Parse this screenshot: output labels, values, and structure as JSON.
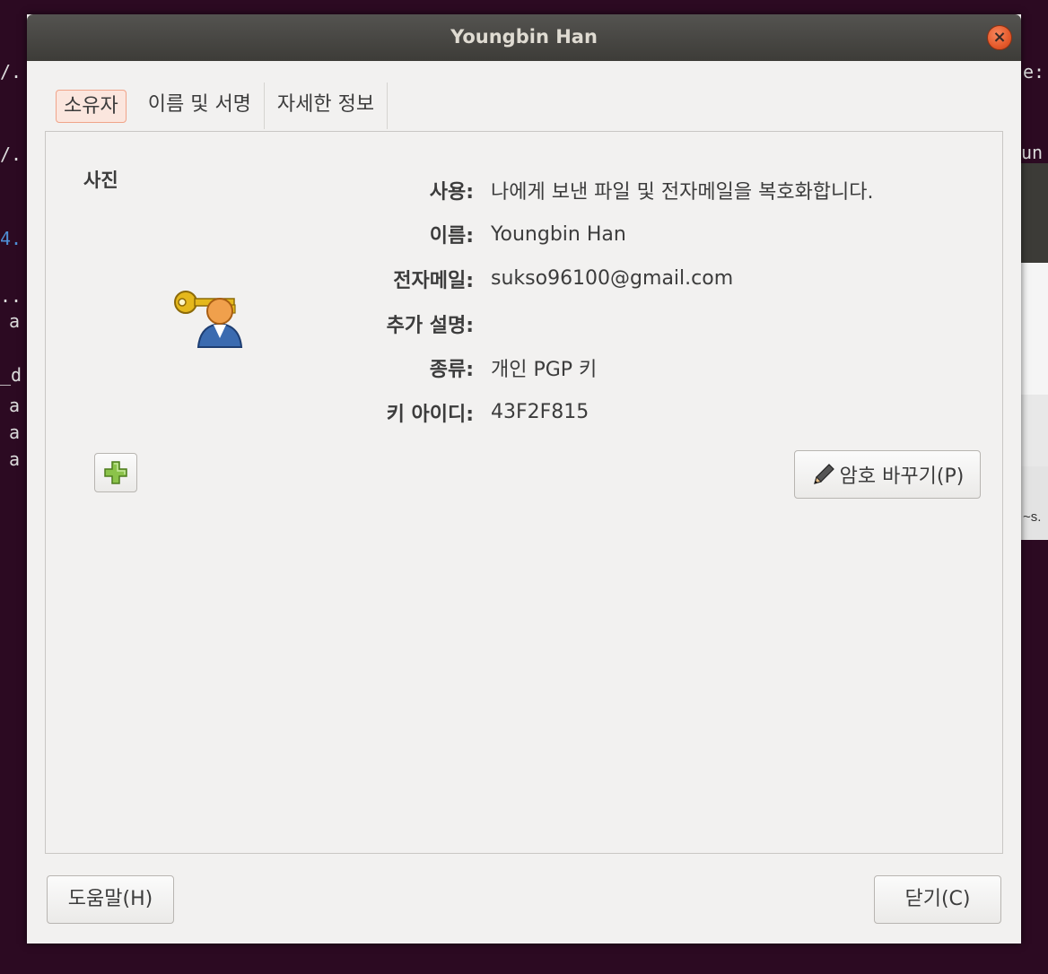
{
  "dialog": {
    "title": "Youngbin Han",
    "close_symbol": "×"
  },
  "tabs": [
    {
      "label": "소유자",
      "active": true
    },
    {
      "label": "이름 및 서명",
      "active": false
    },
    {
      "label": "자세한 정보",
      "active": false
    }
  ],
  "owner": {
    "photo_label": "사진",
    "fields": [
      {
        "key": "사용:",
        "value": "나에게 보낸 파일 및 전자메일을 복호화합니다."
      },
      {
        "key": "이름:",
        "value": "Youngbin Han"
      },
      {
        "key": "전자메일:",
        "value": "sukso96100@gmail.com"
      },
      {
        "key": "추가 설명:",
        "value": ""
      },
      {
        "key": "종류:",
        "value": "개인 PGP 키"
      },
      {
        "key": "키 아이디:",
        "value": "43F2F815"
      }
    ],
    "change_password_label": "암호 바꾸기(P)"
  },
  "footer": {
    "help_label": "도움말(H)",
    "close_label": "닫기(C)"
  },
  "background": {
    "terminal_fragments": [
      "/.",
      "/.",
      "4.",
      "..",
      "a",
      "_d",
      "a",
      "a",
      "a"
    ],
    "right_fragments": [
      "e:",
      "un",
      "~s."
    ]
  }
}
